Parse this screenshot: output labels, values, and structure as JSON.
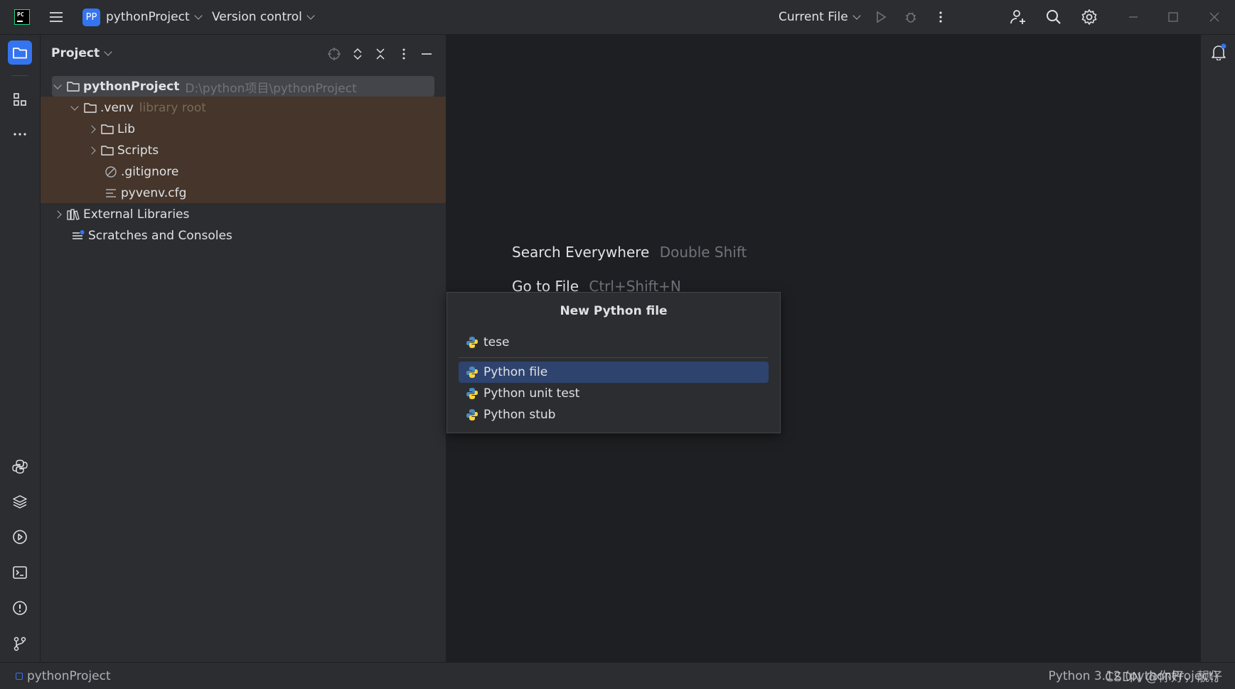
{
  "topbar": {
    "project_badge": "PP",
    "project_name": "pythonProject",
    "vcs": "Version control",
    "run_config": "Current File"
  },
  "panel": {
    "title": "Project"
  },
  "tree": [
    {
      "name": "pythonProject",
      "hint": "D:\\python项目\\pythonProject"
    },
    {
      "name": ".venv",
      "hint": "library root"
    },
    {
      "name": "Lib"
    },
    {
      "name": "Scripts"
    },
    {
      "name": ".gitignore"
    },
    {
      "name": "pyvenv.cfg"
    },
    {
      "name": "External Libraries"
    },
    {
      "name": "Scratches and Consoles"
    }
  ],
  "editor_hints": [
    {
      "action": "Search Everywhere",
      "shortcut": "Double Shift"
    },
    {
      "action": "Go to File",
      "shortcut": "Ctrl+Shift+N"
    }
  ],
  "popup": {
    "title": "New Python file",
    "input_value": "tese",
    "options": [
      "Python file",
      "Python unit test",
      "Python stub"
    ],
    "selected": "Python file"
  },
  "status": {
    "project": "pythonProject",
    "interpreter": "Python 3.12 (pythonProject)",
    "watermark": "CSDN @你好，靓仔"
  },
  "colors": {
    "accent": "#3574f0",
    "selection": "#2e436e",
    "venv_highlight": "#45352a",
    "background": "#2b2d30",
    "editor": "#1e1f22"
  },
  "icons": [
    "pycharm-logo-icon",
    "hamburger-menu-icon",
    "run-icon",
    "debug-icon",
    "more-vertical-icon",
    "add-user-icon",
    "search-icon",
    "settings-gear-icon",
    "minimize-icon",
    "maximize-icon",
    "close-icon",
    "folder-icon",
    "structure-icon",
    "more-horizontal-icon",
    "python-console-icon",
    "layers-icon",
    "services-icon",
    "terminal-icon",
    "problems-icon",
    "git-branch-icon",
    "notifications-bell-icon",
    "locate-icon",
    "expand-all-icon",
    "collapse-all-icon",
    "python-file-icon"
  ]
}
